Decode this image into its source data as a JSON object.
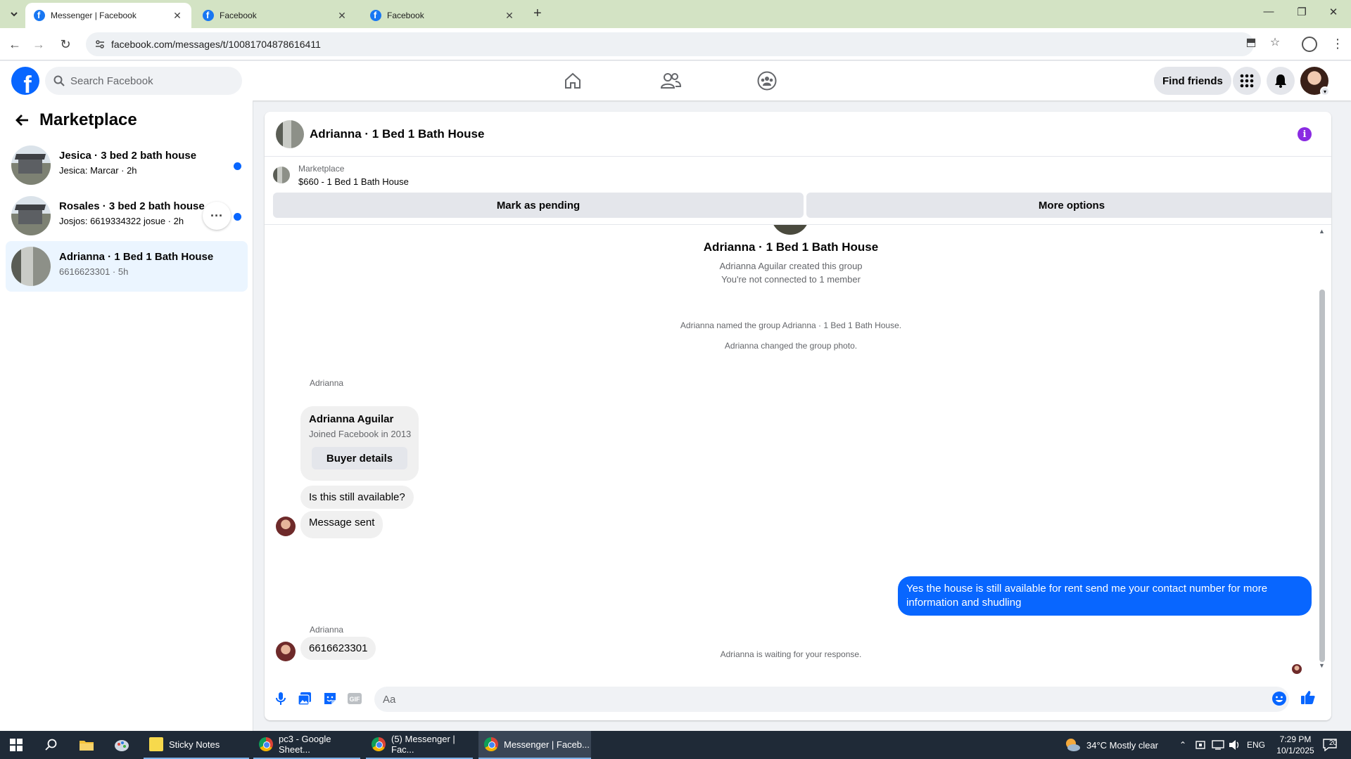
{
  "browser": {
    "tabs": [
      {
        "title": "Messenger | Facebook",
        "active": true
      },
      {
        "title": "Facebook",
        "active": false
      },
      {
        "title": "Facebook",
        "active": false
      }
    ],
    "url": "facebook.com/messages/t/10081704878616411"
  },
  "fb_header": {
    "search_placeholder": "Search Facebook",
    "find_friends_label": "Find friends",
    "brand_color": "#0866ff"
  },
  "sidebar": {
    "title": "Marketplace",
    "conversations": [
      {
        "title": "Jesica · 3 bed 2 bath house",
        "subtitle": "Jesica: Marcar · 2h",
        "unread": true,
        "selected": false
      },
      {
        "title": "Rosales · 3 bed 2 bath house",
        "subtitle": "Josjos: 6619334322 josue · 2h",
        "unread": true,
        "selected": false
      },
      {
        "title": "Adrianna · 1 Bed 1 Bath House",
        "subtitle": "6616623301 · 5h",
        "unread": false,
        "selected": true
      }
    ]
  },
  "chat": {
    "title": "Adrianna · 1 Bed 1 Bath House",
    "marketplace_label": "Marketplace",
    "listing": "$660 - 1 Bed 1 Bath House",
    "mark_pending_label": "Mark as pending",
    "more_options_label": "More options",
    "intro_title": "Adrianna · 1 Bed 1 Bath House",
    "intro_created": "Adrianna Aguilar created this group",
    "intro_connected": "You're not connected to 1 member",
    "event_named": "Adrianna named the group Adrianna · 1 Bed 1 Bath House.",
    "event_photo": "Adrianna changed the group photo.",
    "sender_name": "Adrianna",
    "buyer_card": {
      "name": "Adrianna Aguilar",
      "joined": "Joined Facebook in 2013",
      "button": "Buyer details"
    },
    "msg_available": "Is this still available?",
    "msg_sent": "Message sent",
    "waiting_note": "Adrianna is waiting for your response.",
    "outgoing_message": "Yes the house is still available for rent send me your contact number for more information and shudling",
    "sender_name_2": "Adrianna",
    "msg_phone": "6616623301",
    "composer_placeholder": "Aa",
    "accent_color": "#0866ff"
  },
  "taskbar": {
    "items": [
      {
        "label": "Sticky Notes"
      },
      {
        "label": "pc3 - Google Sheet..."
      },
      {
        "label": "(5) Messenger | Fac..."
      },
      {
        "label": "Messenger | Faceb..."
      }
    ],
    "weather": "34°C  Mostly clear",
    "language": "ENG",
    "time": "7:29 PM",
    "date": "10/1/2025",
    "notification_count": "20"
  }
}
